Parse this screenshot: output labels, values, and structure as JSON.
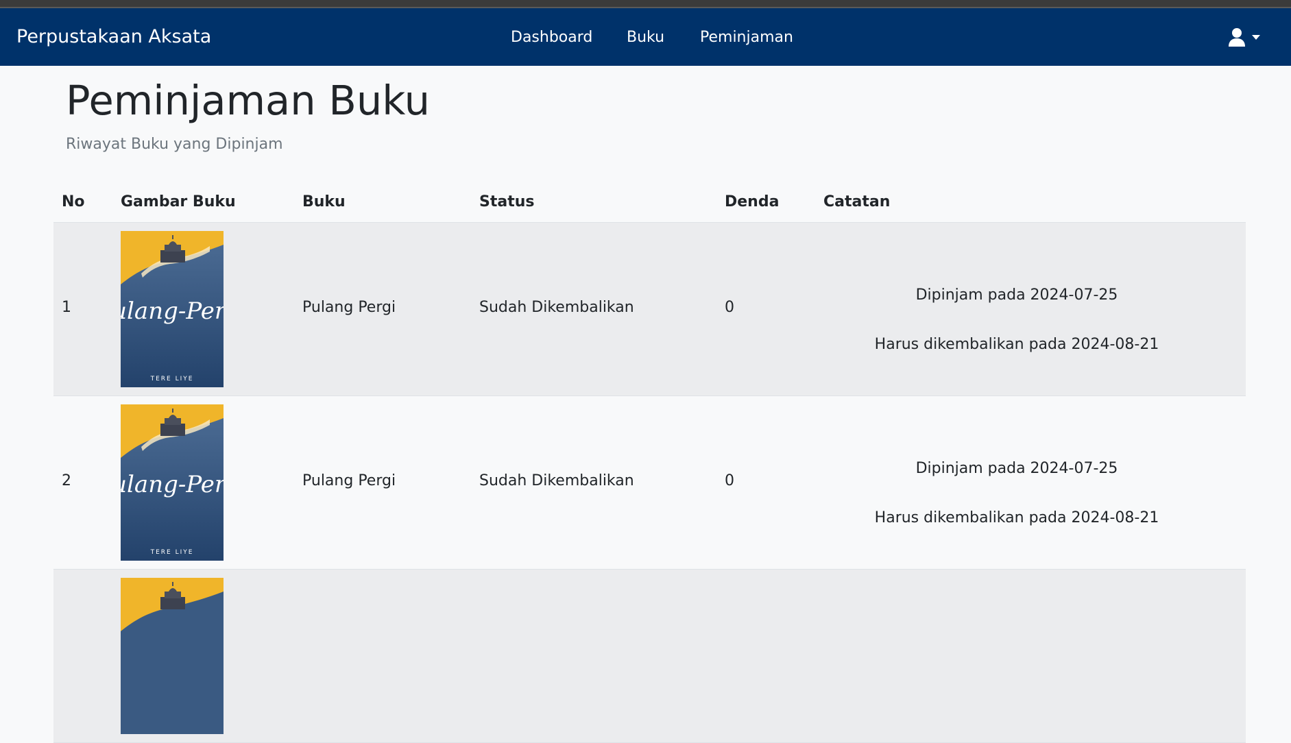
{
  "navbar": {
    "brand": "Perpustakaan Aksata",
    "links": [
      "Dashboard",
      "Buku",
      "Peminjaman"
    ],
    "user_icon": "user-icon",
    "caret_icon": "caret-down-icon",
    "background_color": "#00326a"
  },
  "page": {
    "title": "Peminjaman Buku",
    "subtitle": "Riwayat Buku yang Dipinjam"
  },
  "table": {
    "headers": {
      "no": "No",
      "image": "Gambar Buku",
      "book": "Buku",
      "status": "Status",
      "fine": "Denda",
      "notes": "Catatan"
    },
    "rows": [
      {
        "no": "1",
        "cover_title": "Pulang-Pergi",
        "cover_author": "TERE LIYE",
        "book": "Pulang Pergi",
        "status": "Sudah Dikembalikan",
        "fine": "0",
        "borrowed_note": "Dipinjam pada 2024-07-25",
        "due_note": "Harus dikembalikan pada 2024-08-21"
      },
      {
        "no": "2",
        "cover_title": "Pulang-Pergi",
        "cover_author": "TERE LIYE",
        "book": "Pulang Pergi",
        "status": "Sudah Dikembalikan",
        "fine": "0",
        "borrowed_note": "Dipinjam pada 2024-07-25",
        "due_note": "Harus dikembalikan pada 2024-08-21"
      },
      {
        "no": "",
        "cover_title": "",
        "cover_author": "",
        "book": "",
        "status": "",
        "fine": "",
        "borrowed_note": "",
        "due_note": ""
      }
    ]
  }
}
